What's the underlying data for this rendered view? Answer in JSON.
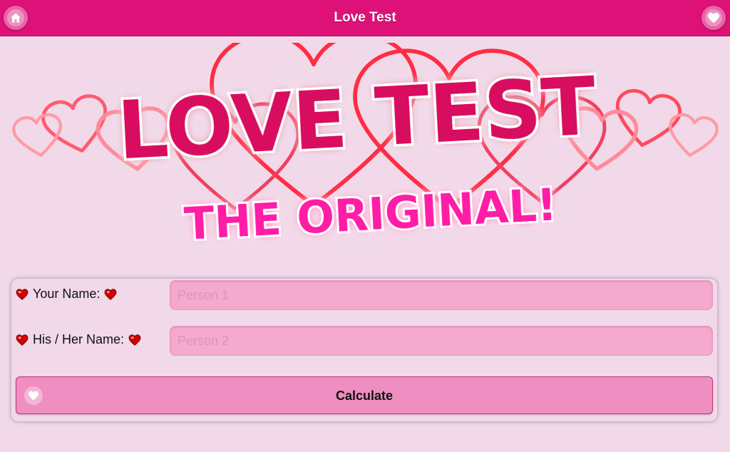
{
  "header": {
    "title": "Love Test",
    "home_icon": "home-icon",
    "heart_icon": "heart-icon"
  },
  "banner": {
    "title": "LOVE TEST",
    "subtitle": "THE ORIGINAL!"
  },
  "form": {
    "your_name_label": "Your Name:",
    "your_name_placeholder": "Person 1",
    "your_name_value": "",
    "partner_name_label": "His / Her Name:",
    "partner_name_placeholder": "Person 2",
    "partner_name_value": "",
    "calculate_label": "Calculate"
  },
  "colors": {
    "header_bg": "#de1179",
    "page_bg": "#f1d9ea",
    "input_bg": "#f4a9cf",
    "button_bg": "#ef8ec0",
    "logo_title": "#d8105e",
    "logo_subtitle": "#ff1fa6"
  }
}
